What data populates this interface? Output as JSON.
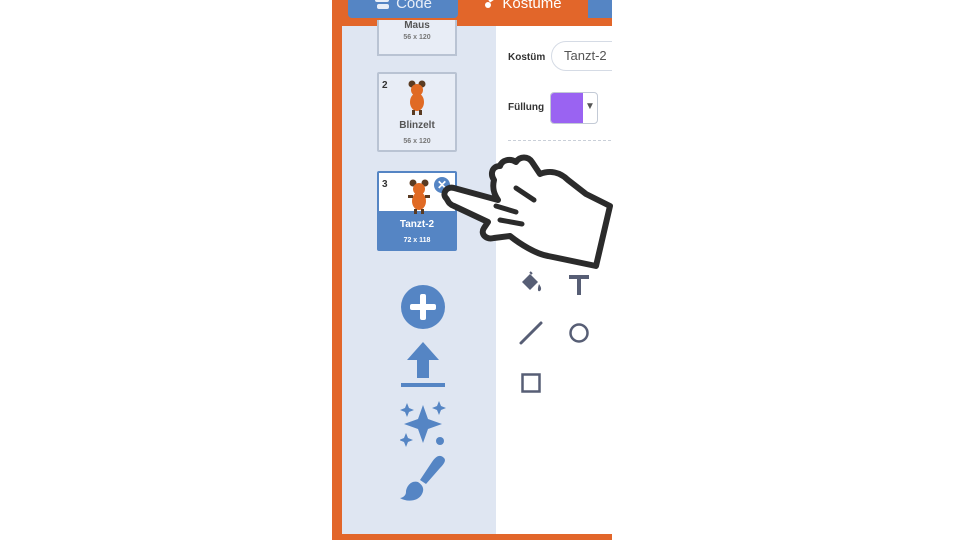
{
  "tabs": {
    "code": "Code",
    "costumes": "Kostüme"
  },
  "costumes": [
    {
      "number": "",
      "name": "Maus",
      "size": "56 x 120"
    },
    {
      "number": "2",
      "name": "Blinzelt",
      "size": "56 x 120"
    },
    {
      "number": "3",
      "name": "Tanzt-2",
      "size": "72 x 118",
      "selected": true
    }
  ],
  "editor": {
    "costume_label": "Kostüm",
    "costume_name": "Tanzt-2",
    "fill_label": "Füllung",
    "fill_color": "#9a63f2"
  },
  "side_actions": [
    "add-circle-icon",
    "upload-icon",
    "sparkle-surprise-icon",
    "paint-brush-icon"
  ],
  "tools": [
    "fill-bucket-icon",
    "text-icon",
    "line-icon",
    "circle-icon",
    "rectangle-icon"
  ],
  "colors": {
    "frame": "#e2662a",
    "accent": "#5585c4",
    "panel": "#dfe6f2"
  }
}
